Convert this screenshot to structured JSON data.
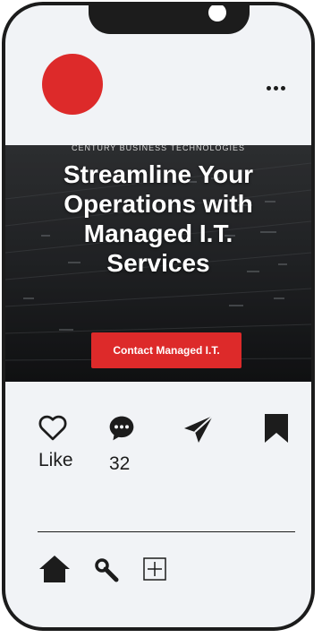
{
  "post": {
    "eyebrow": "CENTURY BUSINESS TECHNOLOGIES",
    "headline": [
      "Streamline Your",
      "Operations with",
      "Managed I.T.",
      "Services"
    ],
    "cta_label": "Contact Managed I.T."
  },
  "actions": {
    "like_label": "Like",
    "comment_count": "32"
  },
  "icons": {
    "like": "heart-icon",
    "comment": "chat-bubble-icon",
    "share": "send-icon",
    "save": "bookmark-icon",
    "home": "home-icon",
    "search": "search-icon",
    "add": "add-box-icon",
    "more": "more-dots-icon"
  },
  "colors": {
    "accent": "#dd2a2a",
    "frame": "#1c1c1c",
    "screen": "#f1f3f6"
  }
}
